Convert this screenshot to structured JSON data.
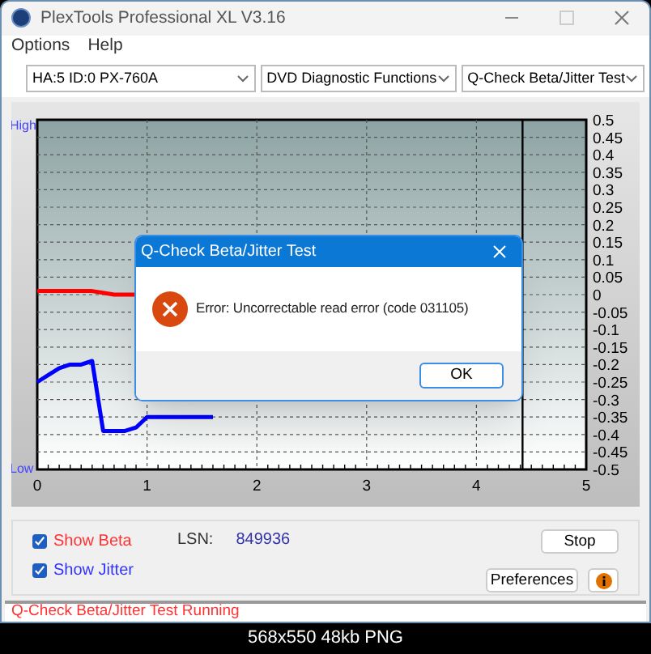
{
  "window": {
    "title": "PlexTools Professional XL V3.16"
  },
  "menu": [
    {
      "label": "Options"
    },
    {
      "label": "Help"
    }
  ],
  "dropdowns": [
    {
      "value": "HA:5 ID:0  PX-760A"
    },
    {
      "value": "DVD Diagnostic Functions"
    },
    {
      "value": "Q-Check Beta/Jitter Test"
    }
  ],
  "chart": {
    "high_label": "High",
    "low_label": "Low",
    "chart_data": {
      "type": "line",
      "x": [
        0,
        0.1,
        0.2,
        0.3,
        0.4,
        0.5,
        0.6,
        0.7,
        0.8,
        0.9,
        1.0,
        1.1,
        1.2,
        1.3,
        1.4,
        1.5,
        1.6
      ],
      "xlim": [
        0,
        5
      ],
      "ylim": [
        -0.5,
        0.5
      ],
      "xticks": [
        0,
        1,
        2,
        3,
        4,
        5
      ],
      "yticks": [
        0.5,
        0.45,
        0.4,
        0.35,
        0.3,
        0.25,
        0.2,
        0.15,
        0.1,
        0.05,
        0,
        -0.05,
        -0.1,
        -0.15,
        -0.2,
        -0.25,
        -0.3,
        -0.35,
        -0.4,
        -0.45,
        -0.5
      ],
      "grid": true,
      "series": [
        {
          "color": "#ff0000",
          "values": [
            0.01,
            0.01,
            0.01,
            0.01,
            0.01,
            0.01,
            0.005,
            0.0,
            0.0,
            0.0,
            null,
            null,
            null,
            null,
            null,
            null,
            null
          ]
        },
        {
          "color": "#0000ff",
          "values": [
            -0.25,
            -0.23,
            -0.21,
            -0.2,
            -0.2,
            -0.19,
            -0.39,
            -0.39,
            -0.39,
            -0.38,
            -0.35,
            -0.35,
            -0.35,
            -0.35,
            -0.35,
            -0.35,
            -0.35
          ]
        }
      ],
      "ref_lines": [
        {
          "axis": "x",
          "value": 4.42
        }
      ]
    }
  },
  "dialog": {
    "title": "Q-Check Beta/Jitter Test",
    "message": "Error: Uncorrectable read error (code 031105)",
    "button": "OK"
  },
  "options": [
    {
      "label": "Show Beta",
      "checked": true,
      "color": "#ff3333"
    },
    {
      "label": "Show Jitter",
      "checked": true,
      "color": "#3333ff"
    }
  ],
  "lsn": {
    "label": "LSN:",
    "value": "849936"
  },
  "buttons": {
    "stop": "Stop",
    "preferences": "Preferences"
  },
  "status_bar": "Q-Check Beta/Jitter Test Running",
  "caption": "568x550 48kb PNG"
}
